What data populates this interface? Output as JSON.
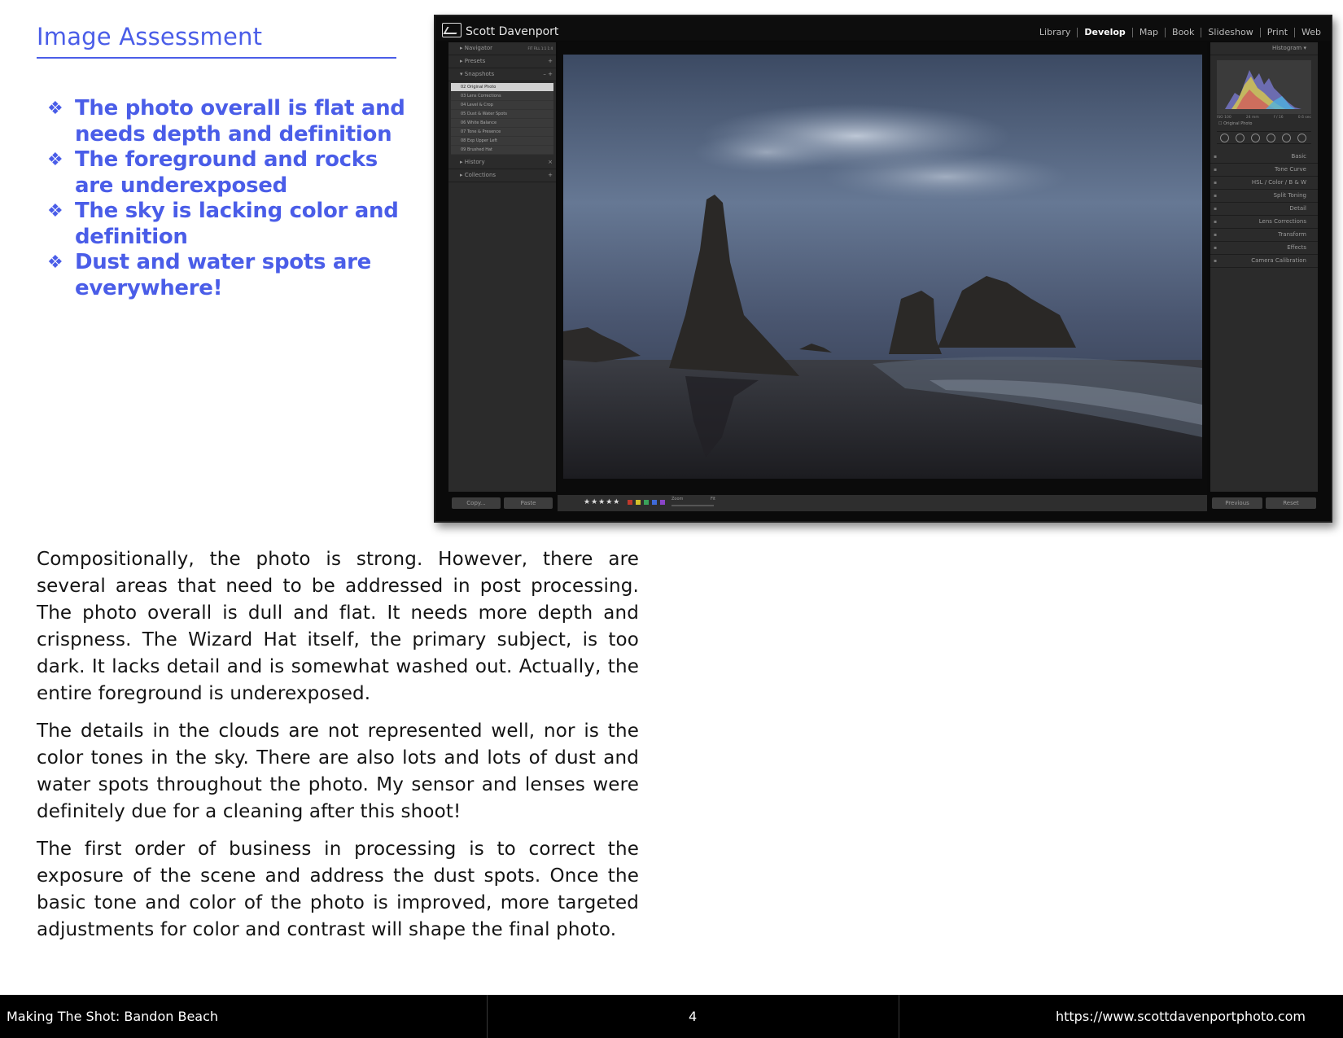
{
  "heading": "Image Assessment",
  "bullets": [
    "The photo overall is flat and needs depth and definition",
    "The foreground and rocks are underexposed",
    "The sky is lacking color and definition",
    "Dust and water spots are everywhere!"
  ],
  "screenshot": {
    "owner_name": "Scott Davenport",
    "modules": [
      "Library",
      "Develop",
      "Map",
      "Book",
      "Slideshow",
      "Print",
      "Web"
    ],
    "active_module": "Develop",
    "left_panels": {
      "navigator": "Navigator",
      "nav_options": "FIT  FILL  1:1  1:4",
      "presets": "Presets",
      "snapshots": "Snapshots",
      "snapshot_items": [
        "02 Original Photo",
        "03 Lens Corrections",
        "04 Level & Crop",
        "05 Dust & Water Spots",
        "06 White Balance",
        "07 Tone & Presence",
        "08 Exp Upper Left",
        "09 Brushed Hat"
      ],
      "history": "History",
      "collections": "Collections"
    },
    "right_panels": {
      "histogram": "Histogram",
      "meta": [
        "ISO 100",
        "24 mm",
        "f / 16",
        "0.6 sec"
      ],
      "original_photo": "Original Photo",
      "items": [
        "Basic",
        "Tone Curve",
        "HSL  /  Color  /  B & W",
        "Split Toning",
        "Detail",
        "Lens Corrections",
        "Transform",
        "Effects",
        "Camera Calibration"
      ]
    },
    "buttons": {
      "copy": "Copy...",
      "paste": "Paste",
      "previous": "Previous",
      "reset": "Reset"
    },
    "toolbar": {
      "stars": "★★★★★",
      "zoom": "Zoom",
      "fit": "Fit"
    }
  },
  "paragraphs": [
    "Compositionally, the photo is strong. However, there are several areas that need to be addressed in post processing. The photo overall is dull and flat. It needs more depth and crispness. The Wizard Hat itself, the primary subject, is too dark. It lacks detail and is somewhat washed out. Actually, the entire foreground is underexposed.",
    "The details in the clouds are not represented well, nor is the color tones in the sky. There are also lots and lots of dust and water spots throughout the photo. My sensor and lenses were definitely due for a cleaning after this shoot!",
    "The first order of business in processing is to correct the exposure of the scene and address the dust spots. Once the basic tone and color of the photo is improved, more targeted adjustments for color and contrast will shape the final photo."
  ],
  "footer": {
    "title": "Making The Shot: Bandon Beach",
    "page_number": "4",
    "url": "https://www.scottdavenportphoto.com"
  }
}
